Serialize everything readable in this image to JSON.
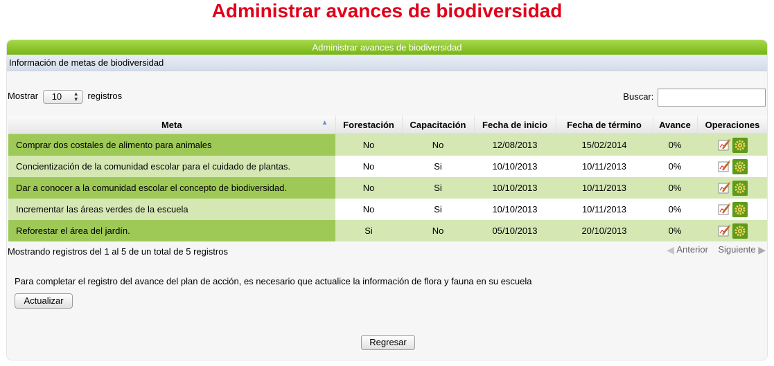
{
  "page": {
    "title": "Administrar avances de biodiversidad"
  },
  "panel": {
    "header": "Administrar avances de biodiversidad",
    "info": "Información de metas de biodiversidad"
  },
  "controls": {
    "show_label": "Mostrar",
    "length_value": "10",
    "records_label": "registros",
    "search_label": "Buscar:",
    "search_value": ""
  },
  "table": {
    "columns": {
      "meta": "Meta",
      "forestacion": "Forestación",
      "capacitacion": "Capacitación",
      "fecha_inicio": "Fecha de inicio",
      "fecha_termino": "Fecha de término",
      "avance": "Avance",
      "operaciones": "Operaciones"
    },
    "rows": [
      {
        "meta": "Comprar dos costales de alimento para animales",
        "forestacion": "No",
        "capacitacion": "No",
        "fecha_inicio": "12/08/2013",
        "fecha_termino": "15/02/2014",
        "avance": "0%"
      },
      {
        "meta": "Concientización de la comunidad escolar para el cuidado de plantas.",
        "forestacion": "No",
        "capacitacion": "Si",
        "fecha_inicio": "10/10/2013",
        "fecha_termino": "10/11/2013",
        "avance": "0%"
      },
      {
        "meta": "Dar a conocer a la comunidad escolar el concepto de biodiversidad.",
        "forestacion": "No",
        "capacitacion": "Si",
        "fecha_inicio": "10/10/2013",
        "fecha_termino": "10/11/2013",
        "avance": "0%"
      },
      {
        "meta": "Incrementar las áreas verdes de la escuela",
        "forestacion": "No",
        "capacitacion": "Si",
        "fecha_inicio": "10/10/2013",
        "fecha_termino": "10/11/2013",
        "avance": "0%"
      },
      {
        "meta": "Reforestar el área del jardín.",
        "forestacion": "Si",
        "capacitacion": "No",
        "fecha_inicio": "05/10/2013",
        "fecha_termino": "20/10/2013",
        "avance": "0%"
      }
    ],
    "row_icons": [
      "edit-icon",
      "gear-icon"
    ]
  },
  "footer": {
    "summary": "Mostrando registros del 1 al 5 de un total de 5 registros",
    "prev": "Anterior",
    "next": "Siguiente"
  },
  "notice": {
    "text": "Para completar el registro del avance del plan de acción, es necesario que actualice la información de flora y fauna en su escuela",
    "update_button": "Actualizar"
  },
  "back_button": "Regresar",
  "colors": {
    "title": "#e0001a",
    "header_green": "#8cc63f",
    "row_dark": "#9ec957",
    "row_light": "#d5e8b4"
  }
}
